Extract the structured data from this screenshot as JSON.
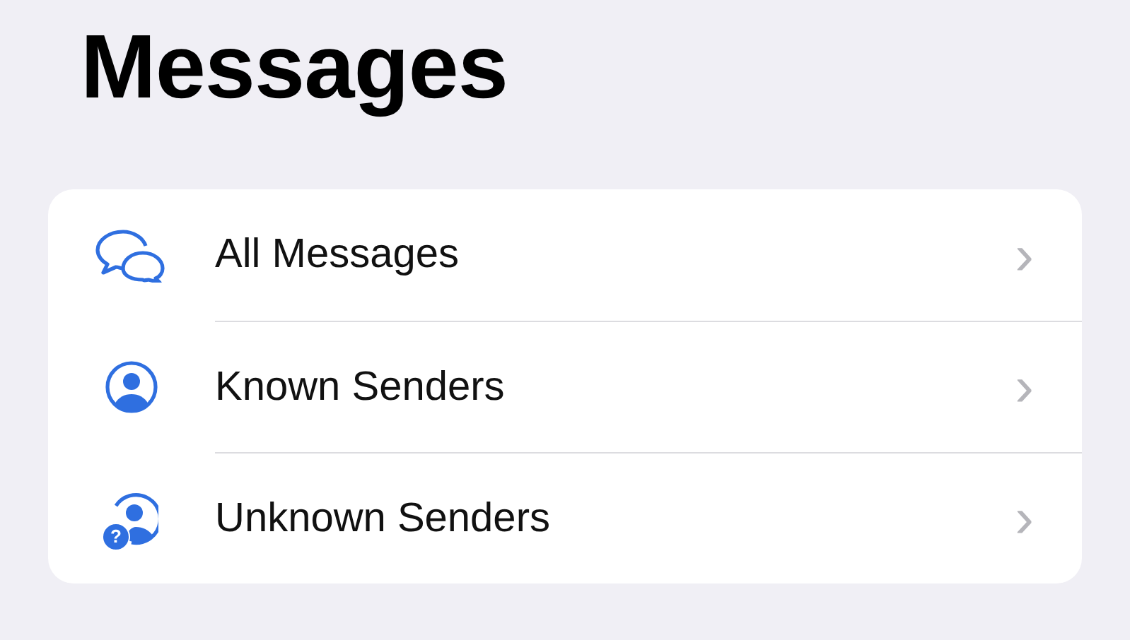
{
  "title": "Messages",
  "items": [
    {
      "kind": "chat",
      "label": "All Messages",
      "chevron": "›"
    },
    {
      "kind": "person",
      "label": "Known Senders",
      "chevron": "›"
    },
    {
      "kind": "unknown",
      "label": "Unknown Senders",
      "chevron": "›",
      "badge": "?"
    }
  ]
}
